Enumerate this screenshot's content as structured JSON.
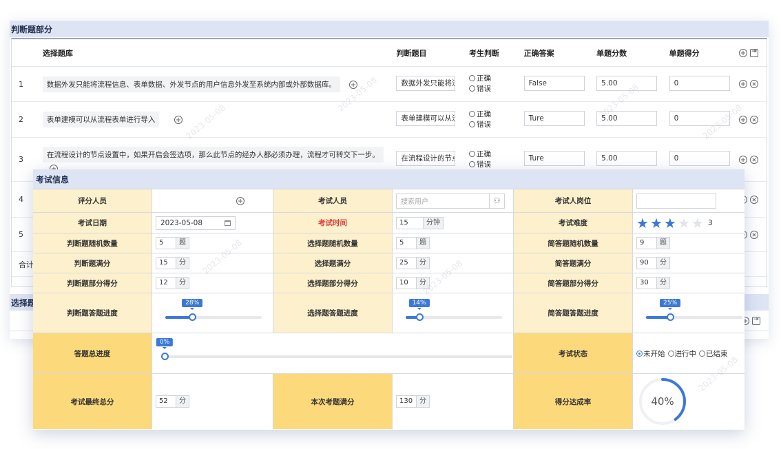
{
  "judge_section": {
    "title": "判断题部分",
    "headers": [
      "选择题库",
      "判断题目",
      "考生判断",
      "正确答案",
      "单题分数",
      "单题得分"
    ],
    "rows": [
      {
        "index": "1",
        "library": "数据外发只能将流程信息、表单数据、外发节点的用户信息外发至系统内部或外部数据库。",
        "question": "数据外发只能将流",
        "options": [
          "正确",
          "错误"
        ],
        "answer": "False",
        "score": "5.00",
        "got": "0"
      },
      {
        "index": "2",
        "library": "表单建模可以从流程表单进行导入",
        "question": "表单建模可以从流",
        "options": [
          "正确",
          "错误"
        ],
        "answer": "Ture",
        "score": "5.00",
        "got": "0"
      },
      {
        "index": "3",
        "library": "在流程设计的节点设置中，如果开启会签选项，那么此节点的经办人都必须办理，流程才可转交下一步。",
        "question": "在流程设计的节点",
        "options": [
          "正确",
          "错误"
        ],
        "answer": "Ture",
        "score": "5.00",
        "got": "0"
      },
      {
        "index": "4"
      },
      {
        "index": "5"
      }
    ],
    "sum_label": "合计"
  },
  "choice_section": {
    "title": "选择题"
  },
  "exam_info": {
    "title": "考试信息",
    "grader_label": "评分人员",
    "examinee_label": "考试人员",
    "examinee_placeholder": "搜索用户",
    "position_label": "考试人岗位",
    "date_label": "考试日期",
    "date_value": "2023-05-08",
    "time_label": "考试时间",
    "time_value": "15",
    "time_unit": "分钟",
    "difficulty_label": "考试难度",
    "difficulty_value": 3,
    "difficulty_max": 5,
    "difficulty_text": "3",
    "judge_count_label": "判断题随机数量",
    "judge_count": "5",
    "choice_count_label": "选择题随机数量",
    "choice_count": "5",
    "short_count_label": "简答题随机数量",
    "short_count": "9",
    "count_unit": "题",
    "judge_full_label": "判断题满分",
    "judge_full": "15",
    "choice_full_label": "选择题满分",
    "choice_full": "25",
    "short_full_label": "简答题满分",
    "short_full": "90",
    "score_unit": "分",
    "judge_part_label": "判断题部分得分",
    "judge_part": "12",
    "choice_part_label": "选择题部分得分",
    "choice_part": "10",
    "short_part_label": "简答题部分得分",
    "short_part": "30",
    "judge_progress_label": "判断题答题进度",
    "judge_progress": 28,
    "judge_progress_text": "28%",
    "choice_progress_label": "选择题答题进度",
    "choice_progress": 14,
    "choice_progress_text": "14%",
    "short_progress_label": "简答题答题进度",
    "short_progress": 25,
    "short_progress_text": "25%",
    "total_progress_label": "答题总进度",
    "total_progress": 0,
    "total_progress_text": "0%",
    "status_label": "考试状态",
    "status_options": [
      "未开始",
      "进行中",
      "已结束"
    ],
    "status_selected": "未开始",
    "final_label": "考试最终总分",
    "final_value": "52",
    "full_label": "本次考题满分",
    "full_value": "130",
    "rate_label": "得分达成率",
    "rate_value": 40,
    "rate_text": "40%"
  },
  "watermark_text": "2023-05-08",
  "colors": {
    "accent": "#3b78d8",
    "label_bg": "#fdf0cc",
    "label_strong_bg": "#fcd97a",
    "header_bg": "#dde5f5",
    "red": "#e23a3a"
  }
}
